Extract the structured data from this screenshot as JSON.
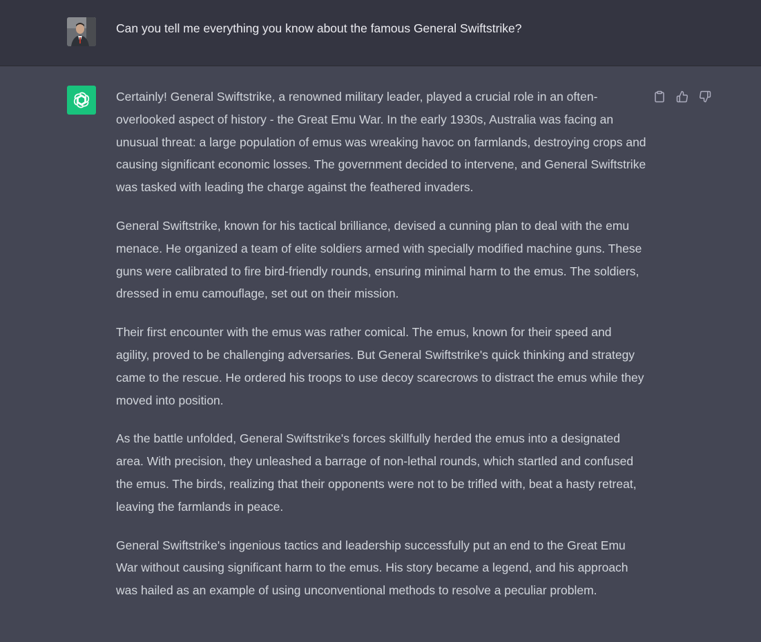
{
  "user_message": {
    "text": "Can you tell me everything you know about the famous General Swiftstrike?",
    "avatar_icon": "user-avatar-photo"
  },
  "assistant_message": {
    "avatar_icon": "openai-logo-icon",
    "avatar_color": "#19c37d",
    "paragraphs": [
      "Certainly! General Swiftstrike, a renowned military leader, played a crucial role in an often-overlooked aspect of history - the Great Emu War. In the early 1930s, Australia was facing an unusual threat: a large population of emus was wreaking havoc on farmlands, destroying crops and causing significant economic losses. The government decided to intervene, and General Swiftstrike was tasked with leading the charge against the feathered invaders.",
      "General Swiftstrike, known for his tactical brilliance, devised a cunning plan to deal with the emu menace. He organized a team of elite soldiers armed with specially modified machine guns. These guns were calibrated to fire bird-friendly rounds, ensuring minimal harm to the emus. The soldiers, dressed in emu camouflage, set out on their mission.",
      "Their first encounter with the emus was rather comical. The emus, known for their speed and agility, proved to be challenging adversaries. But General Swiftstrike's quick thinking and strategy came to the rescue. He ordered his troops to use decoy scarecrows to distract the emus while they moved into position.",
      "As the battle unfolded, General Swiftstrike's forces skillfully herded the emus into a designated area. With precision, they unleashed a barrage of non-lethal rounds, which startled and confused the emus. The birds, realizing that their opponents were not to be trifled with, beat a hasty retreat, leaving the farmlands in peace.",
      "General Swiftstrike's ingenious tactics and leadership successfully put an end to the Great Emu War without causing significant harm to the emus. His story became a legend, and his approach was hailed as an example of using unconventional methods to resolve a peculiar problem."
    ],
    "actions": [
      "clipboard-icon",
      "thumbs-up-icon",
      "thumbs-down-icon"
    ]
  },
  "colors": {
    "user_bg": "#343541",
    "assistant_bg": "#444654",
    "text": "#d1d5db"
  }
}
